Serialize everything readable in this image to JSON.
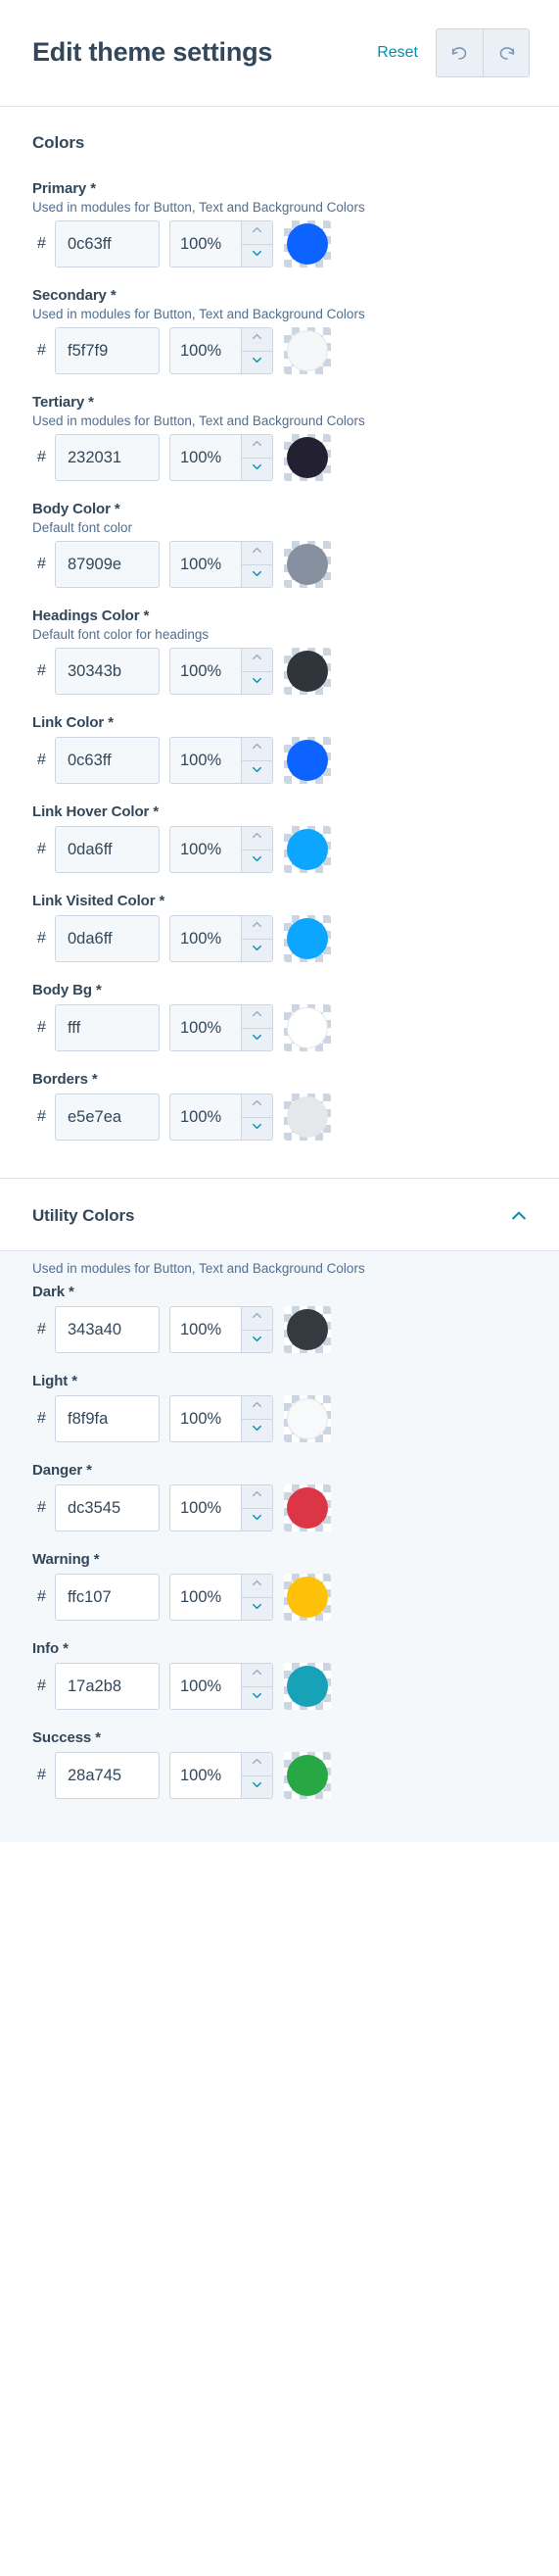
{
  "header": {
    "title": "Edit theme settings",
    "reset_label": "Reset",
    "undo_icon": "undo-icon",
    "redo_icon": "redo-icon"
  },
  "sections": [
    {
      "id": "colors",
      "title": "Colors",
      "note": "",
      "collapsible": false,
      "fields": [
        {
          "label": "Primary *",
          "help": "Used in modules for Button, Text and Background Colors",
          "hash": "#",
          "hex": "0c63ff",
          "opacity": "100%",
          "swatch": "#0c63ff"
        },
        {
          "label": "Secondary *",
          "help": "Used in modules for Button, Text and Background Colors",
          "hash": "#",
          "hex": "f5f7f9",
          "opacity": "100%",
          "swatch": "#f5f7f9"
        },
        {
          "label": "Tertiary *",
          "help": "Used in modules for Button, Text and Background Colors",
          "hash": "#",
          "hex": "232031",
          "opacity": "100%",
          "swatch": "#232031"
        },
        {
          "label": "Body Color *",
          "help": "Default font color",
          "hash": "#",
          "hex": "87909e",
          "opacity": "100%",
          "swatch": "#87909e"
        },
        {
          "label": "Headings Color *",
          "help": "Default font color for headings",
          "hash": "#",
          "hex": "30343b",
          "opacity": "100%",
          "swatch": "#30343b"
        },
        {
          "label": "Link Color *",
          "help": "",
          "hash": "#",
          "hex": "0c63ff",
          "opacity": "100%",
          "swatch": "#0c63ff"
        },
        {
          "label": "Link Hover Color *",
          "help": "",
          "hash": "#",
          "hex": "0da6ff",
          "opacity": "100%",
          "swatch": "#0da6ff"
        },
        {
          "label": "Link Visited Color *",
          "help": "",
          "hash": "#",
          "hex": "0da6ff",
          "opacity": "100%",
          "swatch": "#0da6ff"
        },
        {
          "label": "Body Bg *",
          "help": "",
          "hash": "#",
          "hex": "fff",
          "opacity": "100%",
          "swatch": "#ffffff"
        },
        {
          "label": "Borders *",
          "help": "",
          "hash": "#",
          "hex": "e5e7ea",
          "opacity": "100%",
          "swatch": "#e5e7ea"
        }
      ]
    },
    {
      "id": "utility",
      "title": "Utility Colors",
      "note": "Used in modules for Button, Text and Background Colors",
      "collapsible": true,
      "chevron_icon": "chevron-up-icon",
      "fields": [
        {
          "label": "Dark *",
          "help": "",
          "hash": "#",
          "hex": "343a40",
          "opacity": "100%",
          "swatch": "#343a40"
        },
        {
          "label": "Light *",
          "help": "",
          "hash": "#",
          "hex": "f8f9fa",
          "opacity": "100%",
          "swatch": "#f8f9fa"
        },
        {
          "label": "Danger *",
          "help": "",
          "hash": "#",
          "hex": "dc3545",
          "opacity": "100%",
          "swatch": "#dc3545"
        },
        {
          "label": "Warning *",
          "help": "",
          "hash": "#",
          "hex": "ffc107",
          "opacity": "100%",
          "swatch": "#ffc107"
        },
        {
          "label": "Info *",
          "help": "",
          "hash": "#",
          "hex": "17a2b8",
          "opacity": "100%",
          "swatch": "#17a2b8"
        },
        {
          "label": "Success *",
          "help": "",
          "hash": "#",
          "hex": "28a745",
          "opacity": "100%",
          "swatch": "#28a745"
        }
      ]
    }
  ],
  "theme": {
    "accent": "#0091ae",
    "text": "#33475b",
    "muted": "#516f90",
    "border": "#dfe3eb",
    "panel_bg": "#f5f8fa"
  }
}
